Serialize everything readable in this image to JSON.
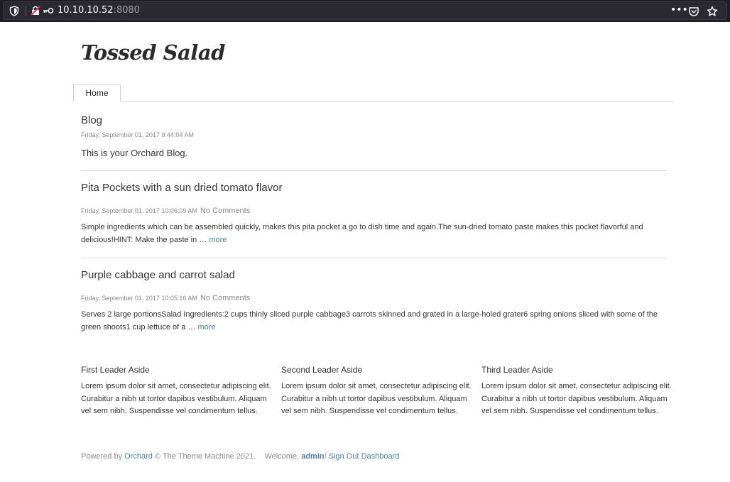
{
  "browser": {
    "url_host": "10.10.10.52",
    "url_port": ":8080",
    "menu_dots": "•••",
    "icons": [
      "shield-icon",
      "insecure-lock-icon",
      "key-icon",
      "pocket-icon",
      "bookmark-star-icon"
    ]
  },
  "site": {
    "title": "Tossed Salad"
  },
  "nav": {
    "tabs": [
      {
        "label": "Home"
      }
    ]
  },
  "blog": {
    "title": "Blog",
    "date": "Friday, September 01, 2017 9:44:04 AM",
    "description": "This is your Orchard Blog."
  },
  "posts": [
    {
      "title": "Pita Pockets with a sun dried tomato flavor",
      "date": "Friday, September 01, 2017 10:06:09 AM",
      "comments": "No Comments",
      "excerpt": "Simple ingredients which can be assembled quickly, makes this pita pocket a go to dish time and again.The sun-dried tomato paste makes this pocket flavorful and delicious!HINT:  Make the paste in … ",
      "more": "more"
    },
    {
      "title": "Purple cabbage and carrot salad",
      "date": "Friday, September 01, 2017 10:05:16 AM",
      "comments": "No Comments",
      "excerpt": "Serves 2 large portionsSalad Ingredients:2 cups thinly sliced purple cabbage3 carrots skinned and grated in a large-holed grater6 spring onions sliced with some of the green shoots1 cup lettuce of a … ",
      "more": "more"
    }
  ],
  "asides": [
    {
      "title": "First Leader Aside",
      "body": "Lorem ipsum dolor sit amet, consectetur adipiscing elit. Curabitur a nibh ut tortor dapibus vestibulum. Aliquam vel sem nibh. Suspendisse vel condimentum tellus."
    },
    {
      "title": "Second Leader Aside",
      "body": "Lorem ipsum dolor sit amet, consectetur adipiscing elit. Curabitur a nibh ut tortor dapibus vestibulum. Aliquam vel sem nibh. Suspendisse vel condimentum tellus."
    },
    {
      "title": "Third Leader Aside",
      "body": "Lorem ipsum dolor sit amet, consectetur adipiscing elit. Curabitur a nibh ut tortor dapibus vestibulum. Aliquam vel sem nibh. Suspendisse vel condimentum tellus."
    }
  ],
  "footer": {
    "powered_by": "Powered by ",
    "orchard_link": "Orchard",
    "copyright": " © The Theme Machine 2021.",
    "welcome": "Welcome, ",
    "user": "admin",
    "bang": "!",
    "sign_out": "Sign Out",
    "dashboard": "Dashboard"
  },
  "colors": {
    "link": "#4a7fa6",
    "url_bar_bg": "#2b2a33",
    "muted_text": "#888888"
  }
}
